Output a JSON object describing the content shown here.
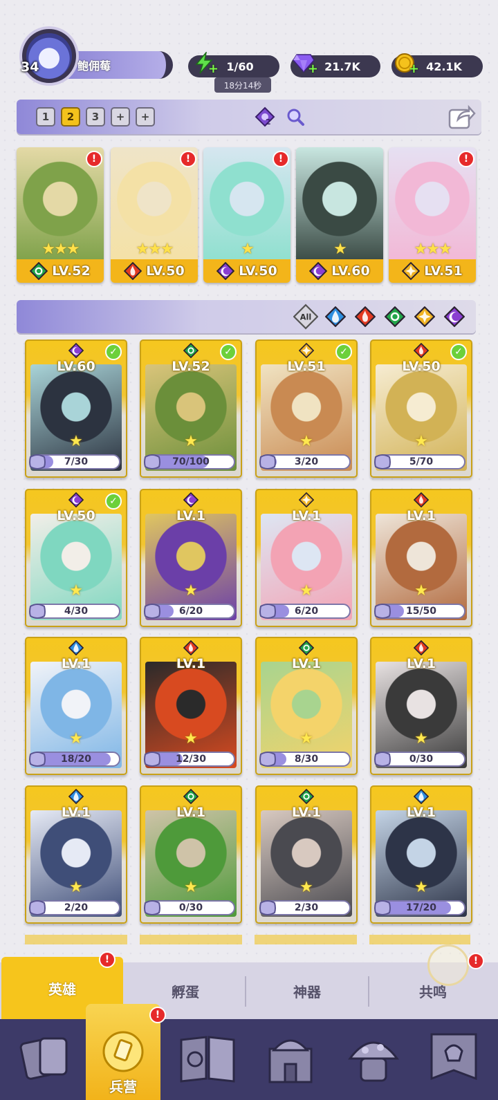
{
  "player": {
    "level": "34",
    "name": "鲍佣莓"
  },
  "resources": {
    "energy": "1/60",
    "energy_timer": "18分14秒",
    "gems": "21.7K",
    "coins": "42.1K"
  },
  "teams": {
    "tabs": [
      "1",
      "2",
      "3",
      "+",
      "+"
    ],
    "active": "2",
    "badge_count": "2"
  },
  "team_cards": [
    {
      "level": "LV.52",
      "stars": "★★★",
      "element": "nature",
      "alert": "!"
    },
    {
      "level": "LV.50",
      "stars": "★★★",
      "element": "fire",
      "alert": "!"
    },
    {
      "level": "LV.50",
      "stars": "★",
      "element": "dark",
      "alert": "!"
    },
    {
      "level": "LV.60",
      "stars": "★",
      "element": "dark",
      "alert": ""
    },
    {
      "level": "LV.51",
      "stars": "★★★",
      "element": "light",
      "alert": "!"
    }
  ],
  "filters": [
    "All",
    "water",
    "fire",
    "nature",
    "light",
    "dark"
  ],
  "heroes": [
    {
      "level": "LV.60",
      "element": "dark",
      "progress": "7/30",
      "ratio": 0.233,
      "check": true,
      "art": [
        "#2c3340",
        "#a9d4d8"
      ]
    },
    {
      "level": "LV.52",
      "element": "nature",
      "progress": "70/100",
      "ratio": 0.7,
      "check": true,
      "art": [
        "#6b8f3a",
        "#d9c47a"
      ]
    },
    {
      "level": "LV.51",
      "element": "light",
      "progress": "3/20",
      "ratio": 0.15,
      "check": true,
      "art": [
        "#c98a52",
        "#f0e3c2"
      ]
    },
    {
      "level": "LV.50",
      "element": "fire",
      "progress": "5/70",
      "ratio": 0.071,
      "check": true,
      "art": [
        "#d2b255",
        "#f6ecd2"
      ]
    },
    {
      "level": "LV.50",
      "element": "dark",
      "progress": "4/30",
      "ratio": 0.133,
      "check": true,
      "art": [
        "#7fd7c0",
        "#f2eee8"
      ]
    },
    {
      "level": "LV.1",
      "element": "dark",
      "progress": "6/20",
      "ratio": 0.3,
      "check": false,
      "art": [
        "#6b3fa8",
        "#e0c660"
      ]
    },
    {
      "level": "LV.1",
      "element": "light",
      "progress": "6/20",
      "ratio": 0.3,
      "check": false,
      "art": [
        "#f3a3b4",
        "#dde6f3"
      ]
    },
    {
      "level": "LV.1",
      "element": "fire",
      "progress": "15/50",
      "ratio": 0.3,
      "check": false,
      "art": [
        "#b26a3e",
        "#eee5d9"
      ]
    },
    {
      "level": "LV.1",
      "element": "water",
      "progress": "18/20",
      "ratio": 0.9,
      "check": false,
      "art": [
        "#7fb6e6",
        "#f1f3f8"
      ]
    },
    {
      "level": "LV.1",
      "element": "fire",
      "progress": "12/30",
      "ratio": 0.4,
      "check": false,
      "art": [
        "#d84a20",
        "#2a2a2a"
      ]
    },
    {
      "level": "LV.1",
      "element": "nature",
      "progress": "8/30",
      "ratio": 0.267,
      "check": false,
      "art": [
        "#f4d36a",
        "#a8d48f"
      ]
    },
    {
      "level": "LV.1",
      "element": "fire",
      "progress": "0/30",
      "ratio": 0.0,
      "check": false,
      "art": [
        "#3a3a3a",
        "#e8e2e2"
      ]
    },
    {
      "level": "LV.1",
      "element": "water",
      "progress": "2/20",
      "ratio": 0.1,
      "check": false,
      "art": [
        "#3f4e78",
        "#e6eaf5"
      ]
    },
    {
      "level": "LV.1",
      "element": "nature",
      "progress": "0/30",
      "ratio": 0.0,
      "check": false,
      "art": [
        "#4e9a3a",
        "#cfc3a8"
      ]
    },
    {
      "level": "LV.1",
      "element": "nature",
      "progress": "2/30",
      "ratio": 0.067,
      "check": false,
      "art": [
        "#4a4a50",
        "#d8c9c0"
      ]
    },
    {
      "level": "LV.1",
      "element": "water",
      "progress": "17/20",
      "ratio": 0.85,
      "check": false,
      "art": [
        "#2d3448",
        "#c4d4e6"
      ]
    }
  ],
  "bottom_tabs": {
    "heroes": "英雄",
    "hatch": "孵蛋",
    "artifact": "神器",
    "resonance": "共鸣",
    "alert": "!"
  },
  "nav": {
    "barracks_label": "兵营",
    "alert": "!"
  },
  "colors": {
    "water": "#2e8fe0",
    "fire": "#e23a22",
    "nature": "#22a64a",
    "light": "#f0b322",
    "dark": "#8a3fd1"
  }
}
